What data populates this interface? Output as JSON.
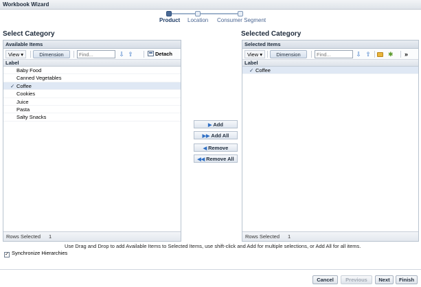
{
  "window": {
    "title": "Workbook Wizard"
  },
  "train": {
    "steps": [
      "Product",
      "Location",
      "Consumer Segment"
    ],
    "active": 0
  },
  "left": {
    "section_title": "Select Category",
    "panel_title": "Available Items",
    "view_label": "View ▾",
    "dimension_label": "Dimension",
    "find_placeholder": "Find...",
    "detach_label": "Detach",
    "column_header": "Label",
    "items": [
      "Baby Food",
      "Canned Vegetables",
      "Coffee",
      "Cookies",
      "Juice",
      "Pasta",
      "Salty Snacks"
    ],
    "selected_index": 2,
    "rows_selected_label": "Rows Selected",
    "rows_selected_count": "1"
  },
  "right": {
    "section_title": "Selected Category",
    "panel_title": "Selected Items",
    "view_label": "View ▾",
    "dimension_label": "Dimension",
    "find_placeholder": "Find...",
    "more_label": "»",
    "column_header": "Label",
    "items": [
      "Coffee"
    ],
    "rows_selected_label": "Rows Selected",
    "rows_selected_count": "1"
  },
  "actions": {
    "add": "Add",
    "add_all": "Add All",
    "remove": "Remove",
    "remove_all": "Remove All"
  },
  "hint": "Use Drag and Drop to add Available Items to Selected Items, use shift-click and Add for multiple selections, or Add All for all items.",
  "sync_label": "Synchronize Hierarchies",
  "sync_checked": true,
  "nav": {
    "cancel": "Cancel",
    "previous": "Previous",
    "next": "Next",
    "finish": "Finish"
  },
  "colors": {
    "accent": "#4b6a95",
    "selection": "#dfe8f4",
    "arrow": "#2f6fc4"
  }
}
